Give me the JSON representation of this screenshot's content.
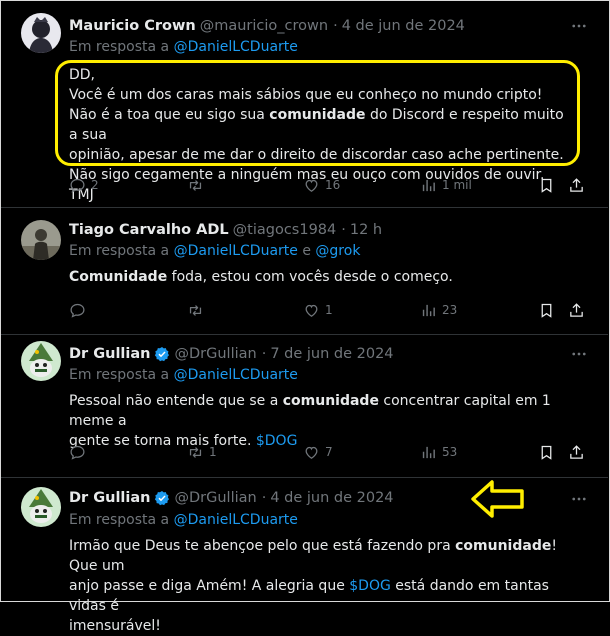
{
  "tweets": [
    {
      "name": "Mauricio Crown",
      "handle": "@mauricio_crown",
      "date": "4 de jun de 2024",
      "reply_prefix": "Em resposta a",
      "reply_to": "@DanielLCDuarte",
      "lines": [
        "DD,",
        "Você é um dos caras mais sábios que eu conheço no mundo cripto!",
        "Não é a toa que eu sigo sua ",
        "comunidade",
        " do Discord e respeito muito a sua",
        "opinião, apesar de me dar o direito de discordar caso ache pertinente.",
        "Não sigo cegamente a ninguém mas eu ouço com ouvidos de ouvir. TMJ"
      ],
      "replies": "2",
      "likes": "16",
      "views": "1 mil"
    },
    {
      "name": "Tiago Carvalho ADL",
      "handle": "@tiagocs1984",
      "date": "12 h",
      "reply_prefix": "Em resposta a",
      "reply_to": "@DanielLCDuarte",
      "reply_and": "e",
      "reply_to2": "@grok",
      "bold": "Comunidade",
      "text": " foda, estou com vocês desde o começo.",
      "likes": "1",
      "views": "23"
    },
    {
      "name": "Dr Gullian",
      "handle": "@DrGullian",
      "date": "7 de jun de 2024",
      "reply_prefix": "Em resposta a",
      "reply_to": "@DanielLCDuarte",
      "line1a": "Pessoal não entende que se a ",
      "bold": "comunidade",
      "line1b": " concentrar capital em 1 meme a",
      "line2": "gente se torna mais forte. ",
      "cashtag": "$DOG",
      "retweets": "1",
      "likes": "7",
      "views": "53"
    },
    {
      "name": "Dr Gullian",
      "handle": "@DrGullian",
      "date": "4 de jun de 2024",
      "reply_prefix": "Em resposta a",
      "reply_to": "@DanielLCDuarte",
      "line1a": "Irmão que Deus te abençoe pelo que está fazendo pra ",
      "bold": "comunidade",
      "line1b": "! Que um",
      "line2a": "anjo passe e diga Amém! A alegria que ",
      "cashtag": "$DOG",
      "line2b": " está dando em tantas vidas é",
      "line3": "imensurável!"
    }
  ],
  "colors": {
    "accent": "#1d9bf0",
    "highlight": "#ffee00",
    "muted": "#71767b"
  }
}
